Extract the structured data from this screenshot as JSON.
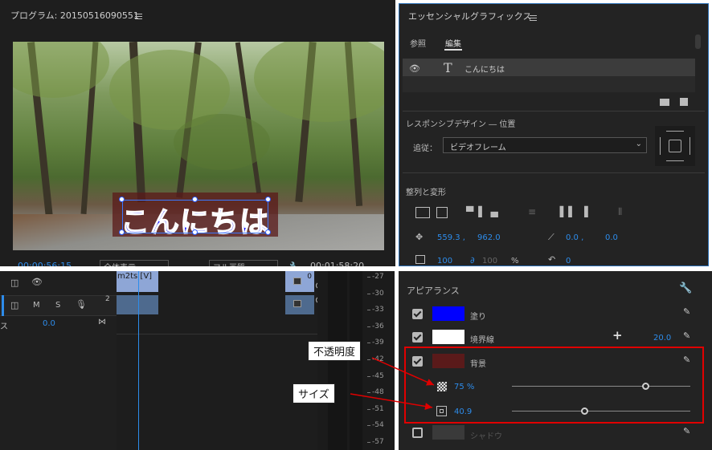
{
  "program": {
    "title": "プログラム: 20150516090551",
    "overlay_text": "こんにちは",
    "timecode_left": "00:00:56:15",
    "zoom": "全体表示",
    "quality": "フル画質",
    "timecode_right": "00:01:58:20"
  },
  "eg": {
    "title": "エッセンシャルグラフィックス",
    "tabs": [
      "参照",
      "編集"
    ],
    "layer_name": "こんにちは",
    "responsive_label": "レスポンシブデザイン ― 位置",
    "follow_label": "追従：",
    "follow_value": "ビデオフレーム",
    "align_label": "整列と変形",
    "pos_x": "559.3 ,",
    "pos_y": "962.0",
    "anchor_x": "0.0 ,",
    "anchor_y": "0.0",
    "scale": "100",
    "scale2": "100",
    "pct": "%",
    "rotation": "0"
  },
  "timeline": {
    "clip_label": "m2ts [V]",
    "track_letters": [
      "M",
      "S"
    ],
    "track_num": "2",
    "value_label": "ス",
    "value": "0.0",
    "clip_marker": "0"
  },
  "meter": {
    "ticks": [
      "-27",
      "-30",
      "-33",
      "-36",
      "-39",
      "-42",
      "-45",
      "-48",
      "-51",
      "-54",
      "-57"
    ]
  },
  "appearance": {
    "title": "アピアランス",
    "fill_label": "塗り",
    "fill_color": "#0000ff",
    "stroke_label": "境界線",
    "stroke_color": "#ffffff",
    "stroke_width": "20.0",
    "bg_label": "背景",
    "bg_color": "#5a1a1a",
    "opacity_value": "75 %",
    "opacity_level": 0.75,
    "size_value": "40.9",
    "size_level": 0.41,
    "shadow_label": "シャドウ"
  },
  "callouts": {
    "opacity": "不透明度",
    "size": "サイズ"
  }
}
